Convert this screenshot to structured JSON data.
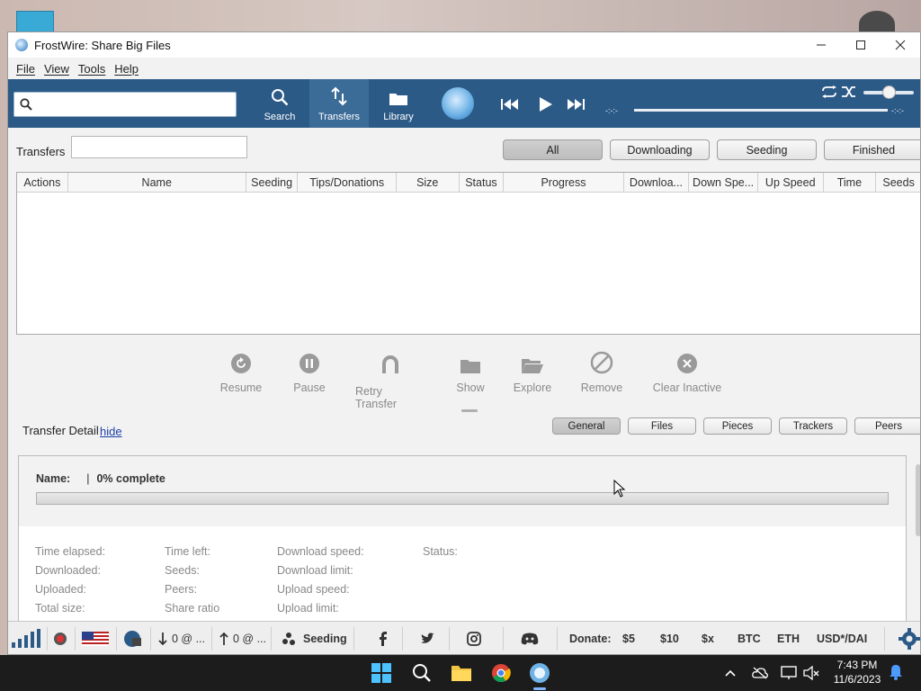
{
  "window": {
    "title": "FrostWire: Share Big Files",
    "minimize": "—",
    "maximize": "▢",
    "close": "✕"
  },
  "menu": [
    "File",
    "View",
    "Tools",
    "Help"
  ],
  "toolbar": {
    "search_value": "",
    "buttons": {
      "search": "Search",
      "transfers": "Transfers",
      "library": "Library"
    },
    "time_elapsed": "-:-:-",
    "time_remaining": "-:-:-",
    "playback_progress": 0,
    "volume": 0.5
  },
  "transfers": {
    "label": "Transfers",
    "filter_value": "",
    "filters": [
      "All",
      "Downloading",
      "Seeding",
      "Finished"
    ],
    "active_filter": "All",
    "columns": [
      "Actions",
      "Name",
      "Seeding",
      "Tips/Donations",
      "Size",
      "Status",
      "Progress",
      "Downloa...",
      "Down Spe...",
      "Up Speed",
      "Time",
      "Seeds"
    ],
    "rows": []
  },
  "actions": {
    "resume": "Resume",
    "pause": "Pause",
    "retry": "Retry Transfer",
    "show": "Show",
    "explore": "Explore",
    "remove": "Remove",
    "clear": "Clear Inactive"
  },
  "detail": {
    "label": "Transfer Detail",
    "hide": "hide",
    "tabs": [
      "General",
      "Files",
      "Pieces",
      "Trackers",
      "Peers"
    ],
    "active_tab": "General",
    "name_label": "Name:",
    "separator": "|",
    "complete_text": "0% complete",
    "progress": 0,
    "col1": [
      "Time elapsed:",
      "Downloaded:",
      "Uploaded:",
      "Total size:"
    ],
    "col2": [
      "Time left:",
      "Seeds:",
      "Peers:",
      "Share ratio"
    ],
    "col3": [
      "Download speed:",
      "Download limit:",
      "Upload speed:",
      "Upload limit:"
    ],
    "col4": [
      "Status:"
    ]
  },
  "statusbar": {
    "down_rate": "0 @ ...",
    "up_rate": "0 @ ...",
    "seeding": "Seeding",
    "donate_label": "Donate:",
    "donate_options": [
      "$5",
      "$10",
      "$x",
      "BTC",
      "ETH",
      "USD*/DAI"
    ]
  },
  "taskbar": {
    "time": "7:43 PM",
    "date": "11/6/2023"
  },
  "colors": {
    "toolbar_bg": "#2c5a87",
    "toolbar_active": "#3b6b97",
    "link": "#1c3ea8"
  }
}
